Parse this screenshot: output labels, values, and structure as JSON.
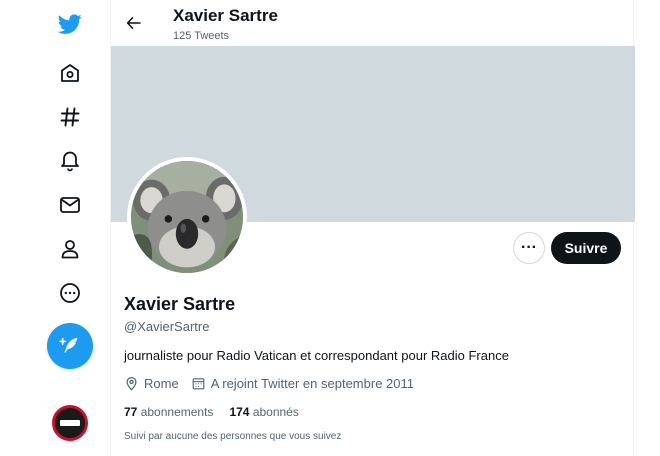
{
  "header": {
    "name": "Xavier Sartre",
    "tweet_count": "125 Tweets"
  },
  "profile": {
    "name": "Xavier Sartre",
    "handle": "@XavierSartre",
    "bio": "journaliste pour Radio Vatican et correspondant pour Radio France",
    "location": "Rome",
    "joined": "A rejoint Twitter en septembre 2011",
    "following_count": "77",
    "following_label": "abonnements",
    "followers_count": "174",
    "followers_label": "abonnés",
    "mutual": "Suivi par aucune des personnes que vous suivez"
  },
  "actions": {
    "more_label": "···",
    "follow_label": "Suivre"
  },
  "sidebar": {
    "items": [
      "twitter-logo",
      "home-icon",
      "explore-icon",
      "notifications-icon",
      "messages-icon",
      "profile-icon",
      "more-icon"
    ]
  },
  "colors": {
    "accent": "#1d9bf0",
    "banner": "#cfd9de",
    "text": "#0f1419",
    "secondary": "#536471"
  }
}
